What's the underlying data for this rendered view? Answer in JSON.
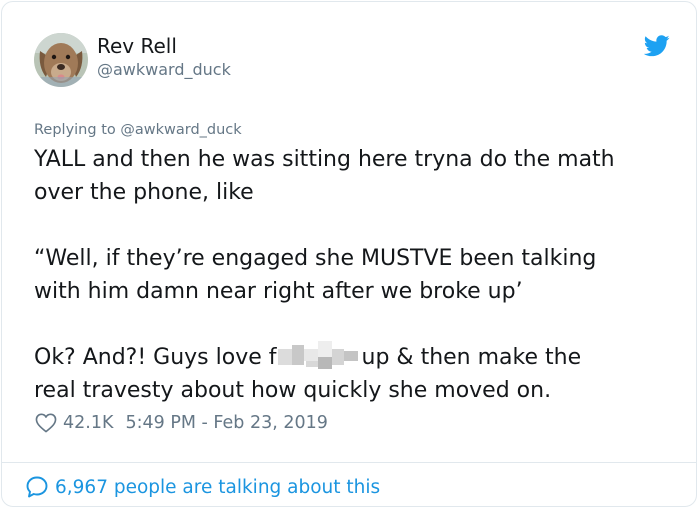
{
  "author": {
    "name": "Rev Rell",
    "handle": "@awkward_duck",
    "avatar_icon": "dog-avatar",
    "brand_icon": "twitter-bird-icon",
    "brand_color": "#1da1f2"
  },
  "tweet": {
    "replying_to": "Replying to @awkward_duck",
    "paragraphs": [
      [
        "YALL and then he was sitting here tryna do the math",
        "over the phone, like"
      ],
      [
        "“Well, if they’re engaged she MUSTVE been talking",
        "with him damn near right after we broke up’"
      ]
    ],
    "last_line_1_before": "Ok? And?! Guys love f",
    "last_line_1_after": "up & then make the",
    "last_line_2": "real travesty about how quickly she moved on."
  },
  "meta": {
    "likes": "42.1K",
    "timestamp": "5:49 PM - Feb 23, 2019"
  },
  "footer": {
    "talking": "6,967 people are talking about this",
    "link_color": "#1b95e0"
  }
}
